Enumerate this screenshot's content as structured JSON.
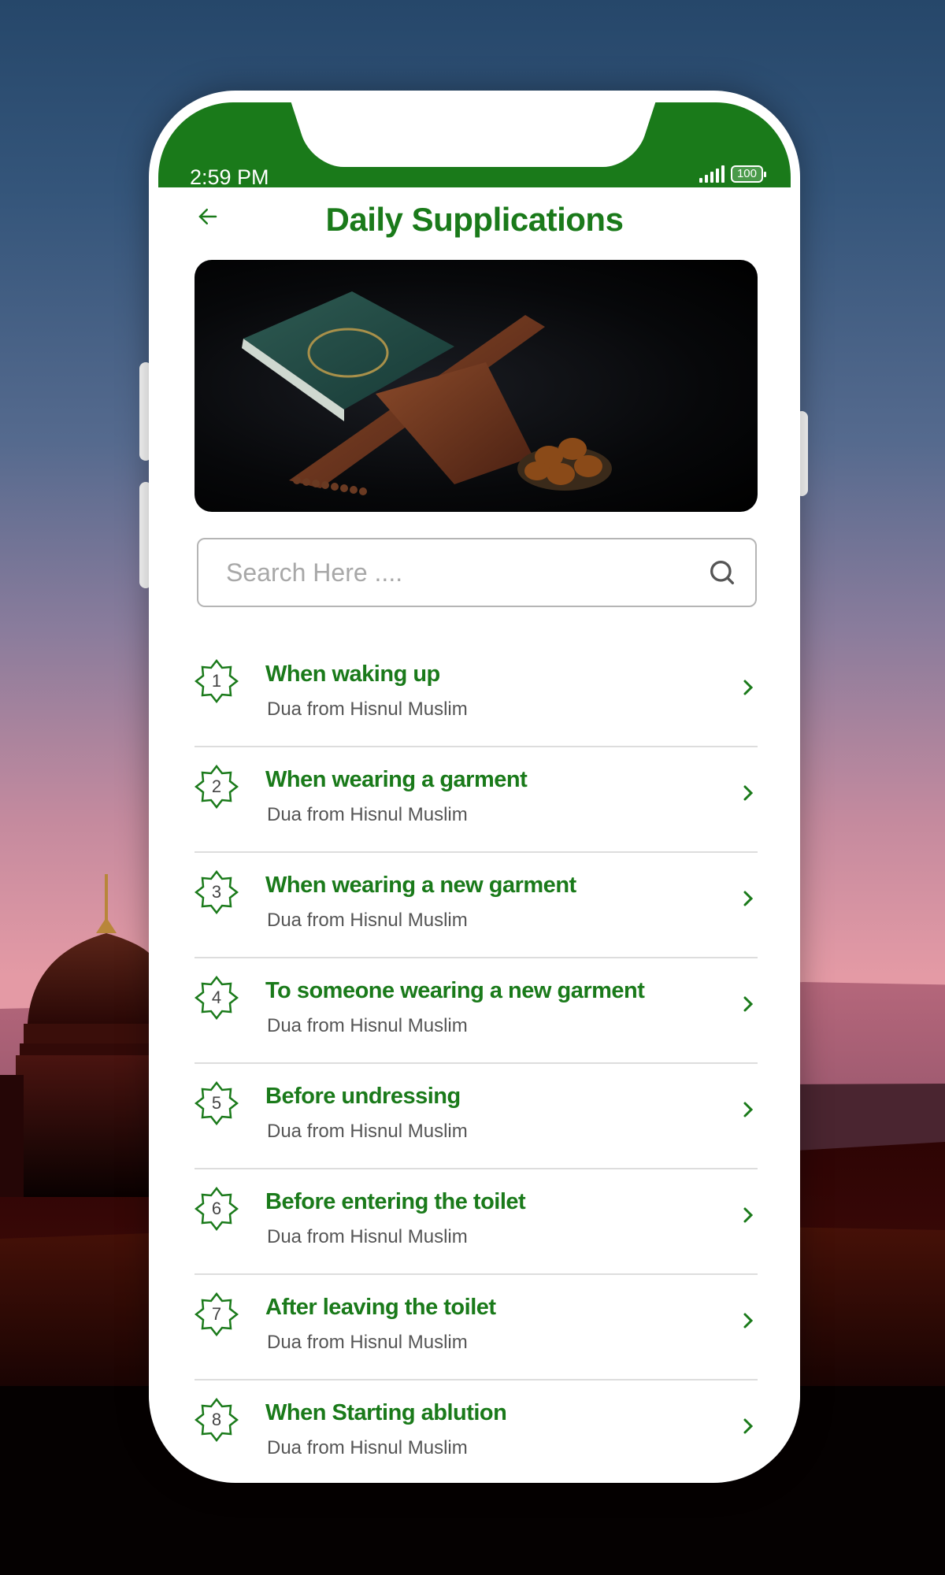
{
  "status_bar": {
    "time": "2:59 PM",
    "battery": "100"
  },
  "header": {
    "back_icon": "arrow-left-icon",
    "title": "Daily Supplications"
  },
  "banner": {
    "description": "Quran on wooden stand with dates and prayer beads"
  },
  "search": {
    "placeholder": "Search Here ....",
    "value": "",
    "icon": "search-icon"
  },
  "colors": {
    "accent": "#1a7a1a",
    "subtitle": "#555555",
    "divider": "#dddddd"
  },
  "list": {
    "items": [
      {
        "number": "1",
        "title": "When waking up",
        "subtitle": "Dua from Hisnul Muslim"
      },
      {
        "number": "2",
        "title": "When wearing a garment",
        "subtitle": "Dua from Hisnul Muslim"
      },
      {
        "number": "3",
        "title": "When wearing a new garment",
        "subtitle": "Dua from Hisnul Muslim"
      },
      {
        "number": "4",
        "title": "To someone wearing a new garment",
        "subtitle": "Dua from Hisnul Muslim"
      },
      {
        "number": "5",
        "title": "Before undressing",
        "subtitle": "Dua from Hisnul Muslim"
      },
      {
        "number": "6",
        "title": "Before entering the toilet",
        "subtitle": "Dua from Hisnul Muslim"
      },
      {
        "number": "7",
        "title": "After leaving the toilet",
        "subtitle": "Dua from Hisnul Muslim"
      },
      {
        "number": "8",
        "title": "When Starting ablution",
        "subtitle": "Dua from Hisnul Muslim"
      }
    ]
  }
}
